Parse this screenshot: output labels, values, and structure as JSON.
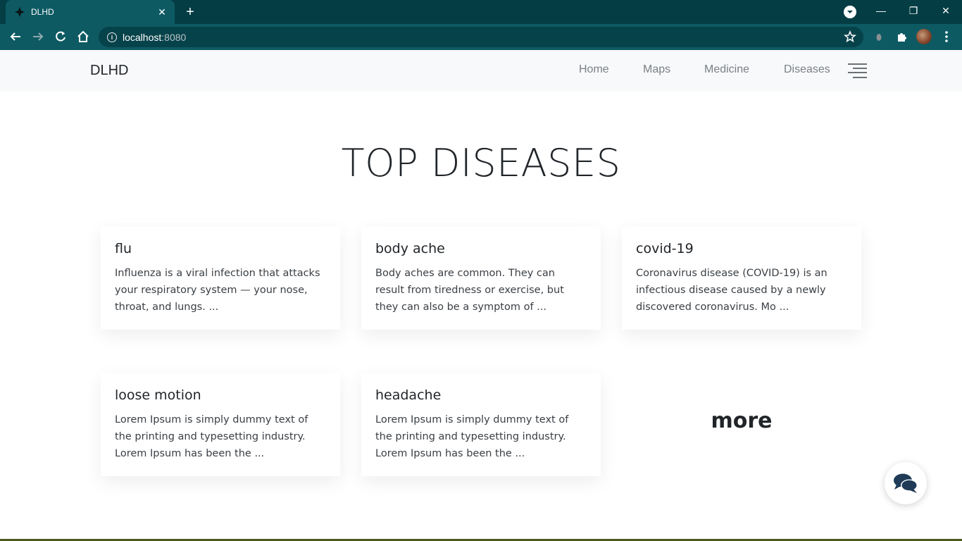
{
  "browser": {
    "tab_title": "DLHD",
    "tab_close": "✕",
    "new_tab": "+",
    "url_host": "localhost",
    "url_port": ":8080",
    "window_controls": {
      "minimize": "—",
      "restore": "❐",
      "close": "✕"
    }
  },
  "navbar": {
    "brand": "DLHD",
    "links": [
      "Home",
      "Maps",
      "Medicine",
      "Diseases"
    ]
  },
  "main": {
    "title": "TOP DISEASES",
    "cards": [
      {
        "title": "flu",
        "text": "Influenza is a viral infection that attacks your respiratory system — your nose, throat, and lungs. ..."
      },
      {
        "title": "body ache",
        "text": "Body aches are common. They can result from tiredness or exercise, but they can also be a symptom of ..."
      },
      {
        "title": "covid-19",
        "text": "Coronavirus disease (COVID-19) is an infectious disease caused by a newly discovered coronavirus. Mo ..."
      },
      {
        "title": "loose motion",
        "text": "Lorem Ipsum is simply dummy text of the printing and typesetting industry. Lorem Ipsum has been the ..."
      },
      {
        "title": "headache",
        "text": "Lorem Ipsum is simply dummy text of the printing and typesetting industry. Lorem Ipsum has been the ..."
      }
    ],
    "more_label": "more"
  },
  "icons": {
    "tab_favicon": "favicon-icon",
    "back": "back-arrow-icon",
    "forward": "forward-arrow-icon",
    "reload": "reload-icon",
    "home": "home-icon",
    "site_info": "info-icon",
    "bookmark": "star-icon",
    "extension": "extension-puzzle-icon",
    "menu": "kebab-menu-icon",
    "hamburger": "hamburger-menu-icon",
    "chat": "chat-bubbles-icon"
  },
  "colors": {
    "browser_frame": "#053d45",
    "browser_toolbar": "#0d5a63",
    "navbar_bg": "#f8f9fa",
    "text_dark": "#212529",
    "nav_link": "#7a7f84",
    "chat_icon": "#1f3b57"
  }
}
